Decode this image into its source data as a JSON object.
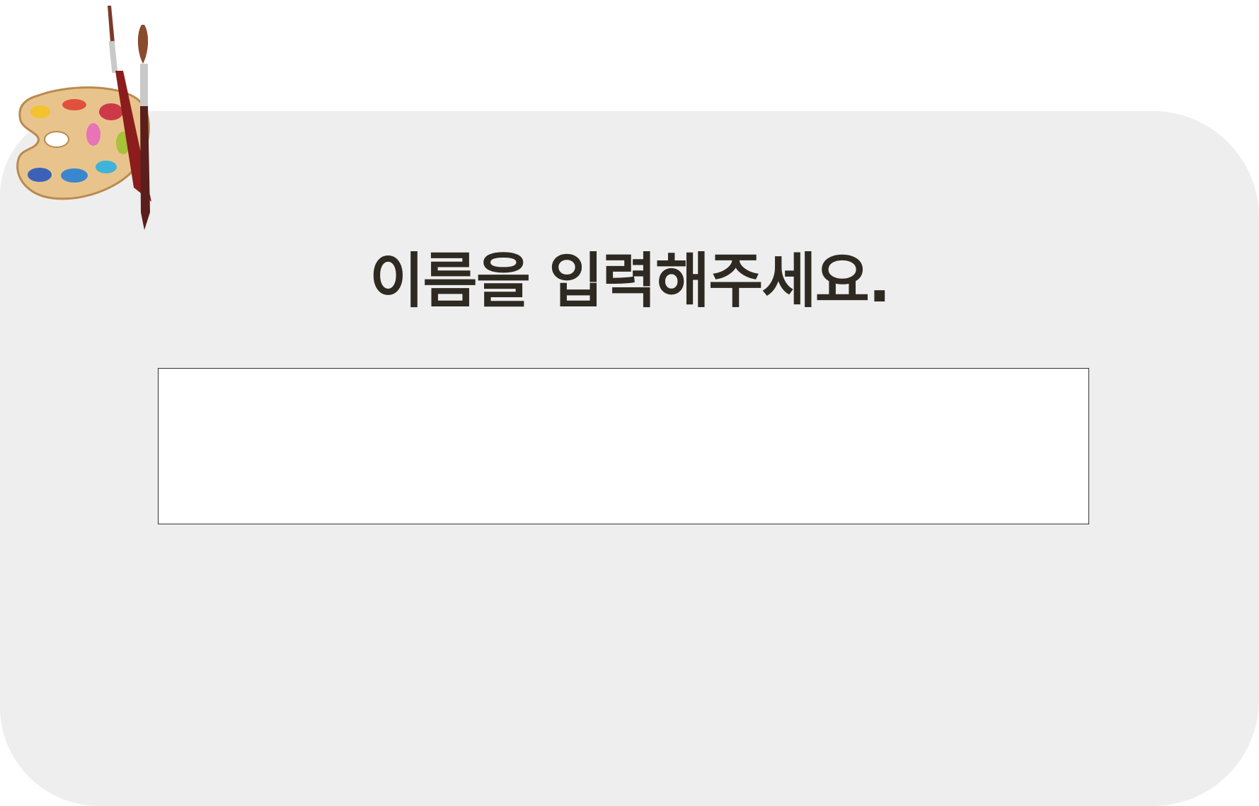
{
  "prompt": {
    "title": "이름을 입력해주세요."
  },
  "name_input": {
    "value": "",
    "placeholder": ""
  },
  "decoration": {
    "icon": "paint-palette-icon",
    "colors": {
      "panel_background": "#eeeeee",
      "title_text": "#2e2a22",
      "palette_wood": "#e8c48c"
    }
  }
}
